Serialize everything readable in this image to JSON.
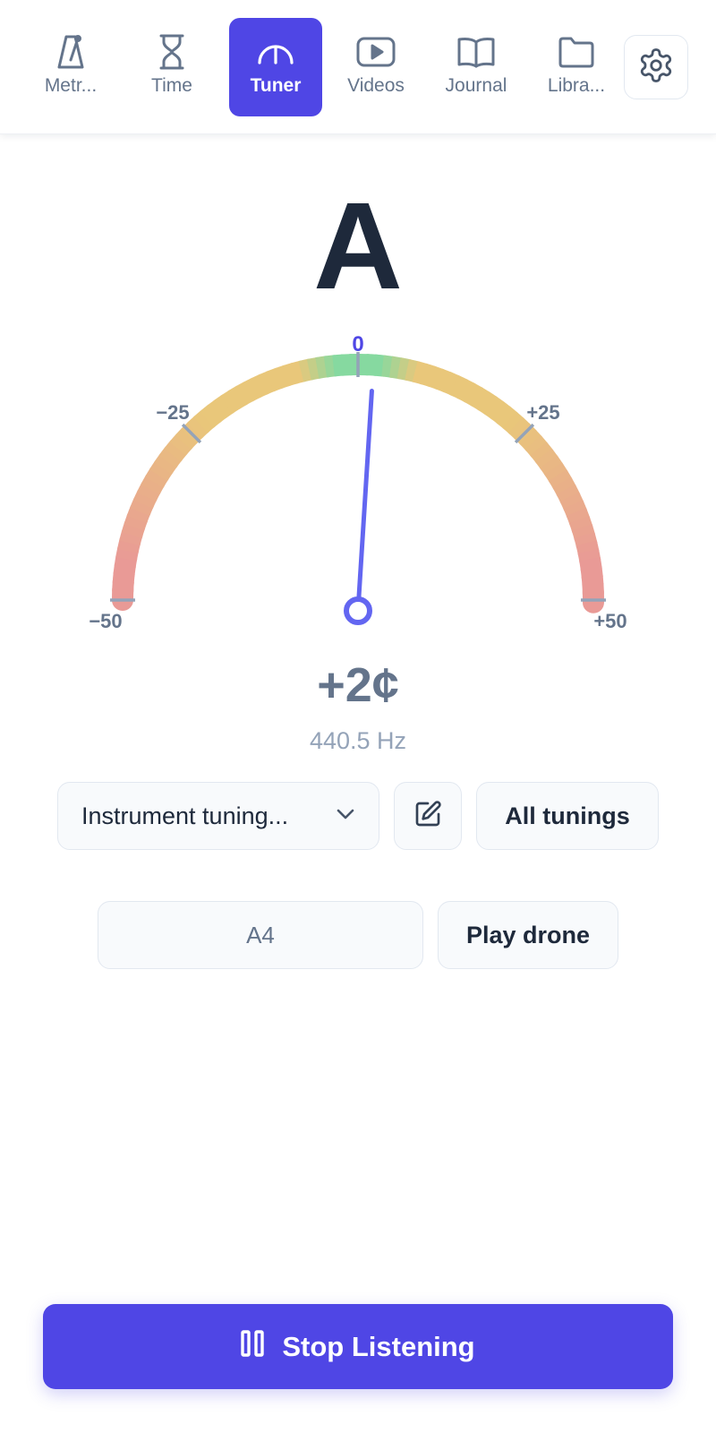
{
  "nav": {
    "tabs": [
      {
        "label": "Metr...",
        "icon": "metronome-icon"
      },
      {
        "label": "Time",
        "icon": "hourglass-icon"
      },
      {
        "label": "Tuner",
        "icon": "tuner-gauge-icon",
        "active": true
      },
      {
        "label": "Videos",
        "icon": "video-icon"
      },
      {
        "label": "Journal",
        "icon": "book-icon"
      },
      {
        "label": "Libra...",
        "icon": "folder-icon"
      }
    ],
    "settings_icon": "gear-icon"
  },
  "tuner": {
    "note": "A",
    "cents_display": "+2¢",
    "cents_value": 2,
    "frequency": "440.5 Hz",
    "scale": {
      "min_label": "−50",
      "low_label": "−25",
      "center_label": "0",
      "high_label": "+25",
      "max_label": "+50"
    }
  },
  "controls": {
    "tuning_select": "Instrument tuning...",
    "edit_icon": "edit-icon",
    "all_tunings": "All tunings",
    "drone_note": "A4",
    "play_drone": "Play drone"
  },
  "footer": {
    "stop_label": "Stop Listening",
    "stop_icon": "pause-icon"
  },
  "colors": {
    "accent": "#4f46e5",
    "needle": "#6366f1",
    "in_tune": "#86d9a0",
    "near": "#e9c77a",
    "off": "#e99a96",
    "text_dark": "#1e293b",
    "text_muted": "#64748b"
  }
}
